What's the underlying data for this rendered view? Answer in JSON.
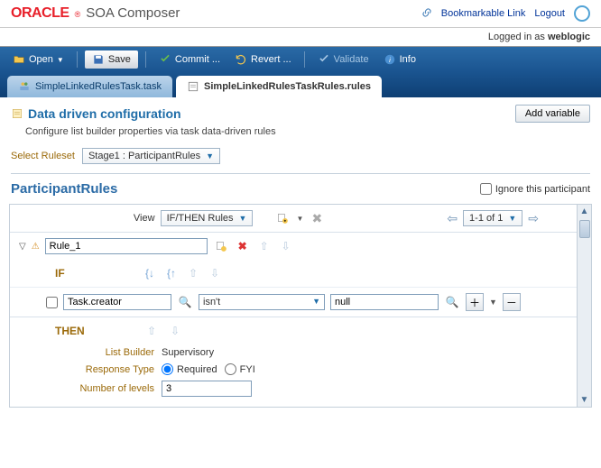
{
  "header": {
    "brand_oracle": "ORACLE",
    "brand_sup": "®",
    "brand_title": "SOA Composer",
    "bookmark_link": "Bookmarkable Link",
    "logout": "Logout",
    "logged_in_prefix": "Logged in as ",
    "logged_in_user": "weblogic"
  },
  "toolbar": {
    "open": "Open",
    "save": "Save",
    "commit": "Commit ...",
    "revert": "Revert ...",
    "validate": "Validate",
    "info": "Info"
  },
  "tabs": {
    "inactive": "SimpleLinkedRulesTask.task",
    "active": "SimpleLinkedRulesTaskRules.rules"
  },
  "section": {
    "title": "Data driven configuration",
    "desc": "Configure list builder properties via task data-driven rules",
    "add_variable": "Add variable",
    "select_ruleset_label": "Select Ruleset",
    "select_ruleset_value": "Stage1 : ParticipantRules"
  },
  "rules": {
    "title": "ParticipantRules",
    "ignore_label": "Ignore this participant",
    "view_label": "View",
    "view_value": "IF/THEN Rules",
    "pager": "1-1 of 1",
    "rule_name": "Rule_1",
    "if_label": "IF",
    "then_label": "THEN",
    "cond_field": "Task.creator",
    "cond_op": "isn't",
    "cond_val": "null",
    "list_builder_label": "List Builder",
    "list_builder_value": "Supervisory",
    "response_type_label": "Response Type",
    "response_required": "Required",
    "response_fyi": "FYI",
    "levels_label": "Number of levels",
    "levels_value": "3"
  }
}
